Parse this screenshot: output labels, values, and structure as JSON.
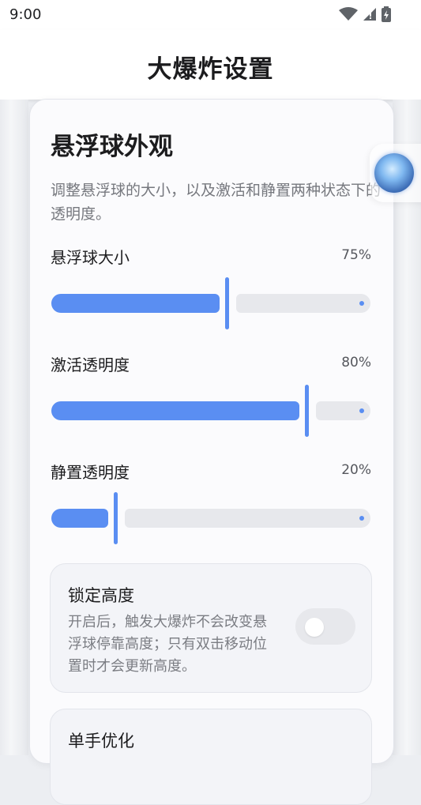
{
  "status_bar": {
    "time": "9:00",
    "icons": [
      "wifi-icon",
      "signal-icon",
      "battery-icon"
    ]
  },
  "app_bar": {
    "title": "大爆炸设置"
  },
  "card": {
    "title": "悬浮球外观",
    "description": "调整悬浮球的大小，以及激活和静置两种状态下的透明度。",
    "sliders": [
      {
        "label": "悬浮球大小",
        "value_text": "75%",
        "value": 0.55
      },
      {
        "label": "激活透明度",
        "value_text": "80%",
        "value": 0.8
      },
      {
        "label": "静置透明度",
        "value_text": "20%",
        "value": 0.2
      }
    ],
    "lock_height": {
      "title": "锁定高度",
      "description": "开启后，触发大爆炸不会改变悬浮球停靠高度；只有双击移动位置时才会更新高度。",
      "enabled": false
    },
    "one_hand": {
      "title": "单手优化"
    }
  },
  "colors": {
    "accent": "#5a8ef2",
    "track_inactive": "#e7e8ec",
    "card_bg": "#fbfbfd"
  }
}
